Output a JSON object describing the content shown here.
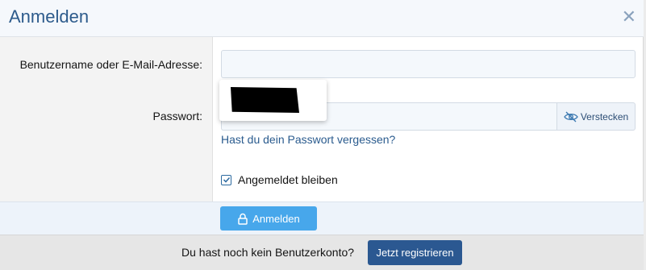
{
  "dialog": {
    "title": "Anmelden",
    "close_icon": "close-icon"
  },
  "form": {
    "username_label": "Benutzername oder E-Mail-Adresse:",
    "username_value": "",
    "password_label": "Passwort:",
    "password_value": "",
    "password_toggle_label": "Verstecken",
    "password_toggle_icon": "eye-slash-icon",
    "forgot_link": "Hast du dein Passwort vergessen?",
    "remember_label": "Angemeldet bleiben",
    "remember_checked": true,
    "submit_label": "Anmelden",
    "submit_icon": "lock-icon"
  },
  "register": {
    "prompt": "Du hast noch kein Benutzerkonto?",
    "button_label": "Jetzt registrieren"
  },
  "colors": {
    "title": "#2d5b8c",
    "primary_button": "#47a7eb",
    "register_button": "#2b5891",
    "link": "#2a5b8e"
  }
}
